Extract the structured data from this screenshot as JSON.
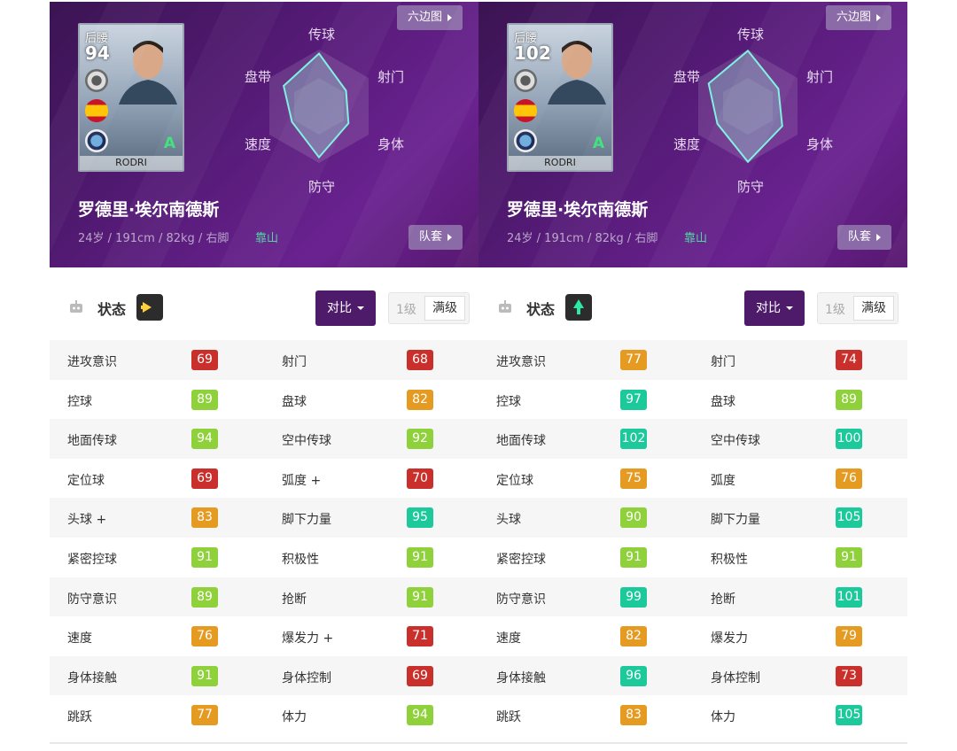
{
  "colors": {
    "red": "#c9302c",
    "orange": "#e59a22",
    "yellowgreen": "#8fd13b",
    "teal": "#1bc99a",
    "header_purple": "#531a74",
    "compare_purple": "#4e1b6b"
  },
  "panels": [
    {
      "card": {
        "position": "后腰",
        "overall": "94",
        "name": "RODRI",
        "grade": "A"
      },
      "player": {
        "name": "罗德里·埃尔南德斯",
        "info": "24岁 / 191cm / 82kg / 右脚",
        "style": "靠山"
      },
      "buttons": {
        "hexagon": "六边图",
        "kit": "队套"
      },
      "radar": {
        "labels": {
          "pass": "传球",
          "shoot": "射门",
          "physical": "身体",
          "defend": "防守",
          "speed": "速度",
          "dribble": "盘带"
        },
        "levels": {
          "pass": 0.93,
          "shoot": 0.55,
          "physical": 0.6,
          "defend": 0.9,
          "speed": 0.55,
          "dribble": 0.72
        }
      },
      "status": {
        "label": "状态",
        "arrow": "right-arrow-icon",
        "arrow_color": "#ffd23c",
        "compare": "对比",
        "level_1": "1级",
        "level_max": "满级"
      },
      "stats": [
        [
          {
            "name": "进攻意识",
            "value": "69",
            "color": "red"
          },
          {
            "name": "射门",
            "value": "68",
            "color": "red"
          }
        ],
        [
          {
            "name": "控球",
            "value": "89",
            "color": "yellowgreen"
          },
          {
            "name": "盘球",
            "value": "82",
            "color": "orange"
          }
        ],
        [
          {
            "name": "地面传球",
            "value": "94",
            "color": "yellowgreen"
          },
          {
            "name": "空中传球",
            "value": "92",
            "color": "yellowgreen"
          }
        ],
        [
          {
            "name": "定位球",
            "value": "69",
            "color": "red"
          },
          {
            "name": "弧度 +",
            "value": "70",
            "color": "red"
          }
        ],
        [
          {
            "name": "头球 +",
            "value": "83",
            "color": "orange"
          },
          {
            "name": "脚下力量",
            "value": "95",
            "color": "teal"
          }
        ],
        [
          {
            "name": "紧密控球",
            "value": "91",
            "color": "yellowgreen"
          },
          {
            "name": "积极性",
            "value": "91",
            "color": "yellowgreen"
          }
        ],
        [
          {
            "name": "防守意识",
            "value": "89",
            "color": "yellowgreen"
          },
          {
            "name": "抢断",
            "value": "91",
            "color": "yellowgreen"
          }
        ],
        [
          {
            "name": "速度",
            "value": "76",
            "color": "orange"
          },
          {
            "name": "爆发力 +",
            "value": "71",
            "color": "red"
          }
        ],
        [
          {
            "name": "身体接触",
            "value": "91",
            "color": "yellowgreen"
          },
          {
            "name": "身体控制",
            "value": "69",
            "color": "red"
          }
        ],
        [
          {
            "name": "跳跃",
            "value": "77",
            "color": "orange"
          },
          {
            "name": "体力",
            "value": "94",
            "color": "yellowgreen"
          }
        ]
      ]
    },
    {
      "card": {
        "position": "后腰",
        "overall": "102",
        "name": "RODRI",
        "grade": "A"
      },
      "player": {
        "name": "罗德里·埃尔南德斯",
        "info": "24岁 / 191cm / 82kg / 右脚",
        "style": "靠山"
      },
      "buttons": {
        "hexagon": "六边图",
        "kit": "队套"
      },
      "radar": {
        "labels": {
          "pass": "传球",
          "shoot": "射门",
          "physical": "身体",
          "defend": "防守",
          "speed": "速度",
          "dribble": "盘带"
        },
        "levels": {
          "pass": 0.98,
          "shoot": 0.62,
          "physical": 0.7,
          "defend": 0.98,
          "speed": 0.62,
          "dribble": 0.8
        }
      },
      "status": {
        "label": "状态",
        "arrow": "up-arrow-icon",
        "arrow_color": "#2ee8a6",
        "compare": "对比",
        "level_1": "1级",
        "level_max": "满级"
      },
      "stats": [
        [
          {
            "name": "进攻意识",
            "value": "77",
            "color": "orange"
          },
          {
            "name": "射门",
            "value": "74",
            "color": "red"
          }
        ],
        [
          {
            "name": "控球",
            "value": "97",
            "color": "teal"
          },
          {
            "name": "盘球",
            "value": "89",
            "color": "yellowgreen"
          }
        ],
        [
          {
            "name": "地面传球",
            "value": "102",
            "color": "teal"
          },
          {
            "name": "空中传球",
            "value": "100",
            "color": "teal"
          }
        ],
        [
          {
            "name": "定位球",
            "value": "75",
            "color": "orange"
          },
          {
            "name": "弧度",
            "value": "76",
            "color": "orange"
          }
        ],
        [
          {
            "name": "头球",
            "value": "90",
            "color": "yellowgreen"
          },
          {
            "name": "脚下力量",
            "value": "105",
            "color": "teal"
          }
        ],
        [
          {
            "name": "紧密控球",
            "value": "91",
            "color": "yellowgreen"
          },
          {
            "name": "积极性",
            "value": "91",
            "color": "yellowgreen"
          }
        ],
        [
          {
            "name": "防守意识",
            "value": "99",
            "color": "teal"
          },
          {
            "name": "抢断",
            "value": "101",
            "color": "teal"
          }
        ],
        [
          {
            "name": "速度",
            "value": "82",
            "color": "orange"
          },
          {
            "name": "爆发力",
            "value": "79",
            "color": "orange"
          }
        ],
        [
          {
            "name": "身体接触",
            "value": "96",
            "color": "teal"
          },
          {
            "name": "身体控制",
            "value": "73",
            "color": "red"
          }
        ],
        [
          {
            "name": "跳跃",
            "value": "83",
            "color": "orange"
          },
          {
            "name": "体力",
            "value": "105",
            "color": "teal"
          }
        ]
      ]
    }
  ]
}
